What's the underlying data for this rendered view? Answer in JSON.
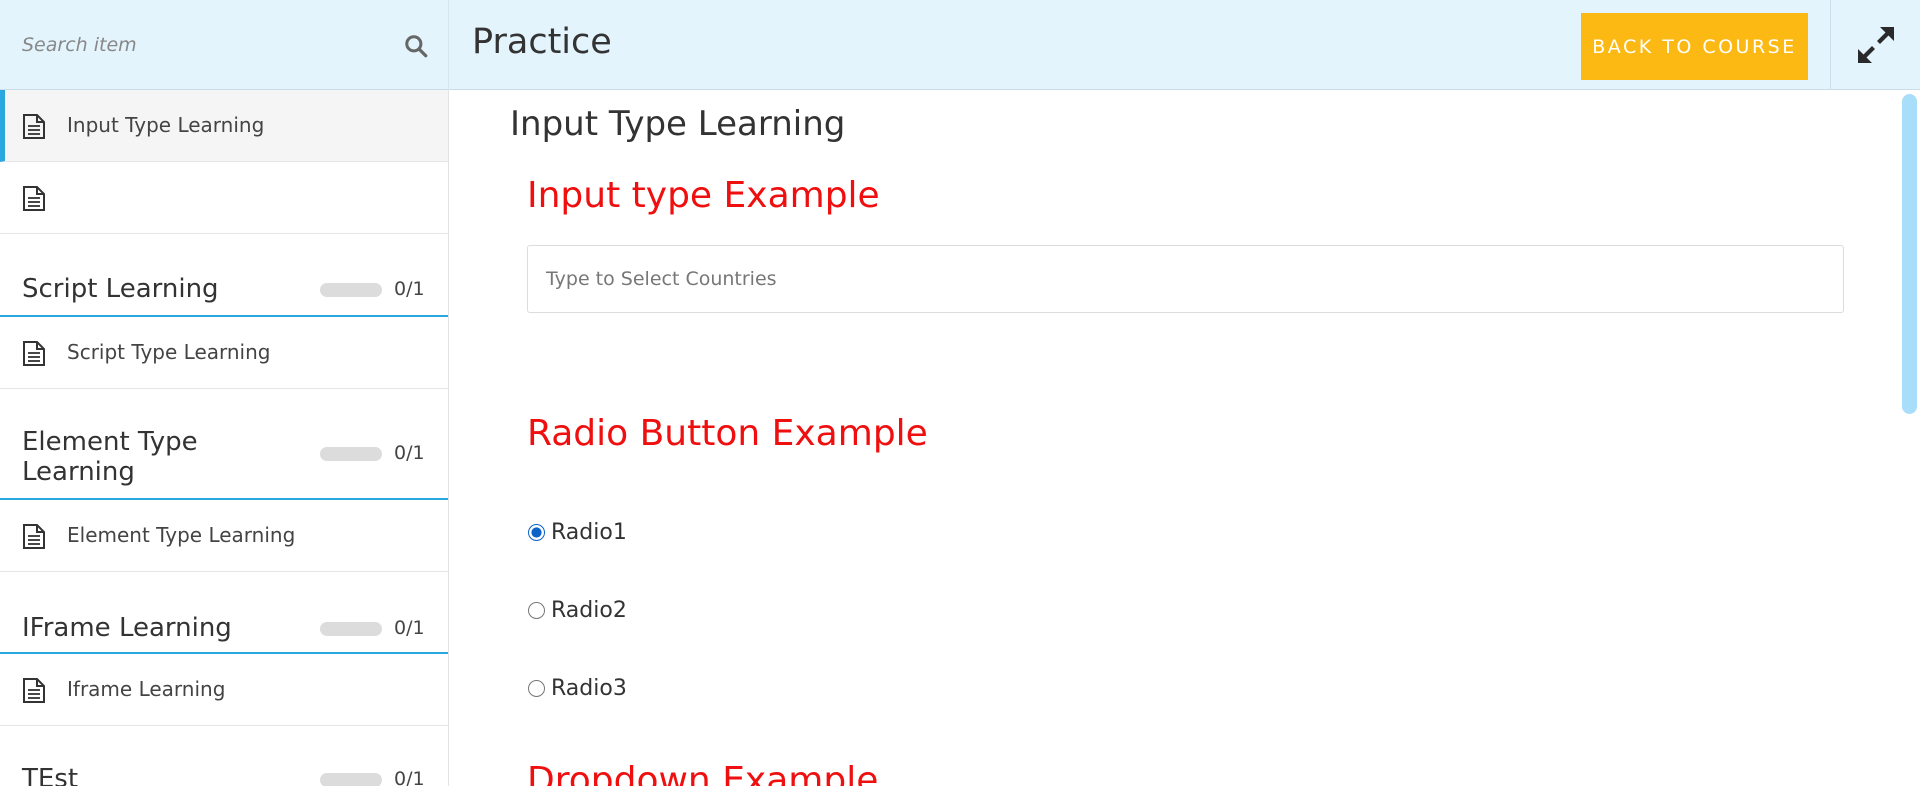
{
  "header": {
    "search_placeholder": "Search item",
    "page_title": "Practice",
    "back_button": "BACK TO COURSE",
    "accent_color": "#fdb913",
    "background_color": "#e3f4fd"
  },
  "sidebar": {
    "active_lesson": "Input Type Learning",
    "untitled_lesson": "",
    "sections": [
      {
        "title": "Script Learning",
        "progress": "0/1",
        "lesson": "Script Type Learning"
      },
      {
        "title": "Element Type Learning",
        "progress": "0/1",
        "lesson": "Element Type Learning"
      },
      {
        "title": "IFrame Learning",
        "progress": "0/1",
        "lesson": "Iframe Learning"
      },
      {
        "title": "TEst",
        "progress": "0/1"
      }
    ],
    "progress_fraction": 0
  },
  "main": {
    "lesson_title": "Input Type Learning",
    "input_example_heading": "Input type Example",
    "country_placeholder": "Type to Select Countries",
    "radio_example_heading": "Radio Button Example",
    "radios": [
      {
        "label": "Radio1",
        "checked": true
      },
      {
        "label": "Radio2",
        "checked": false
      },
      {
        "label": "Radio3",
        "checked": false
      }
    ],
    "dropdown_example_heading": "Dropdown Example",
    "heading_color": "#ef0f0f"
  }
}
